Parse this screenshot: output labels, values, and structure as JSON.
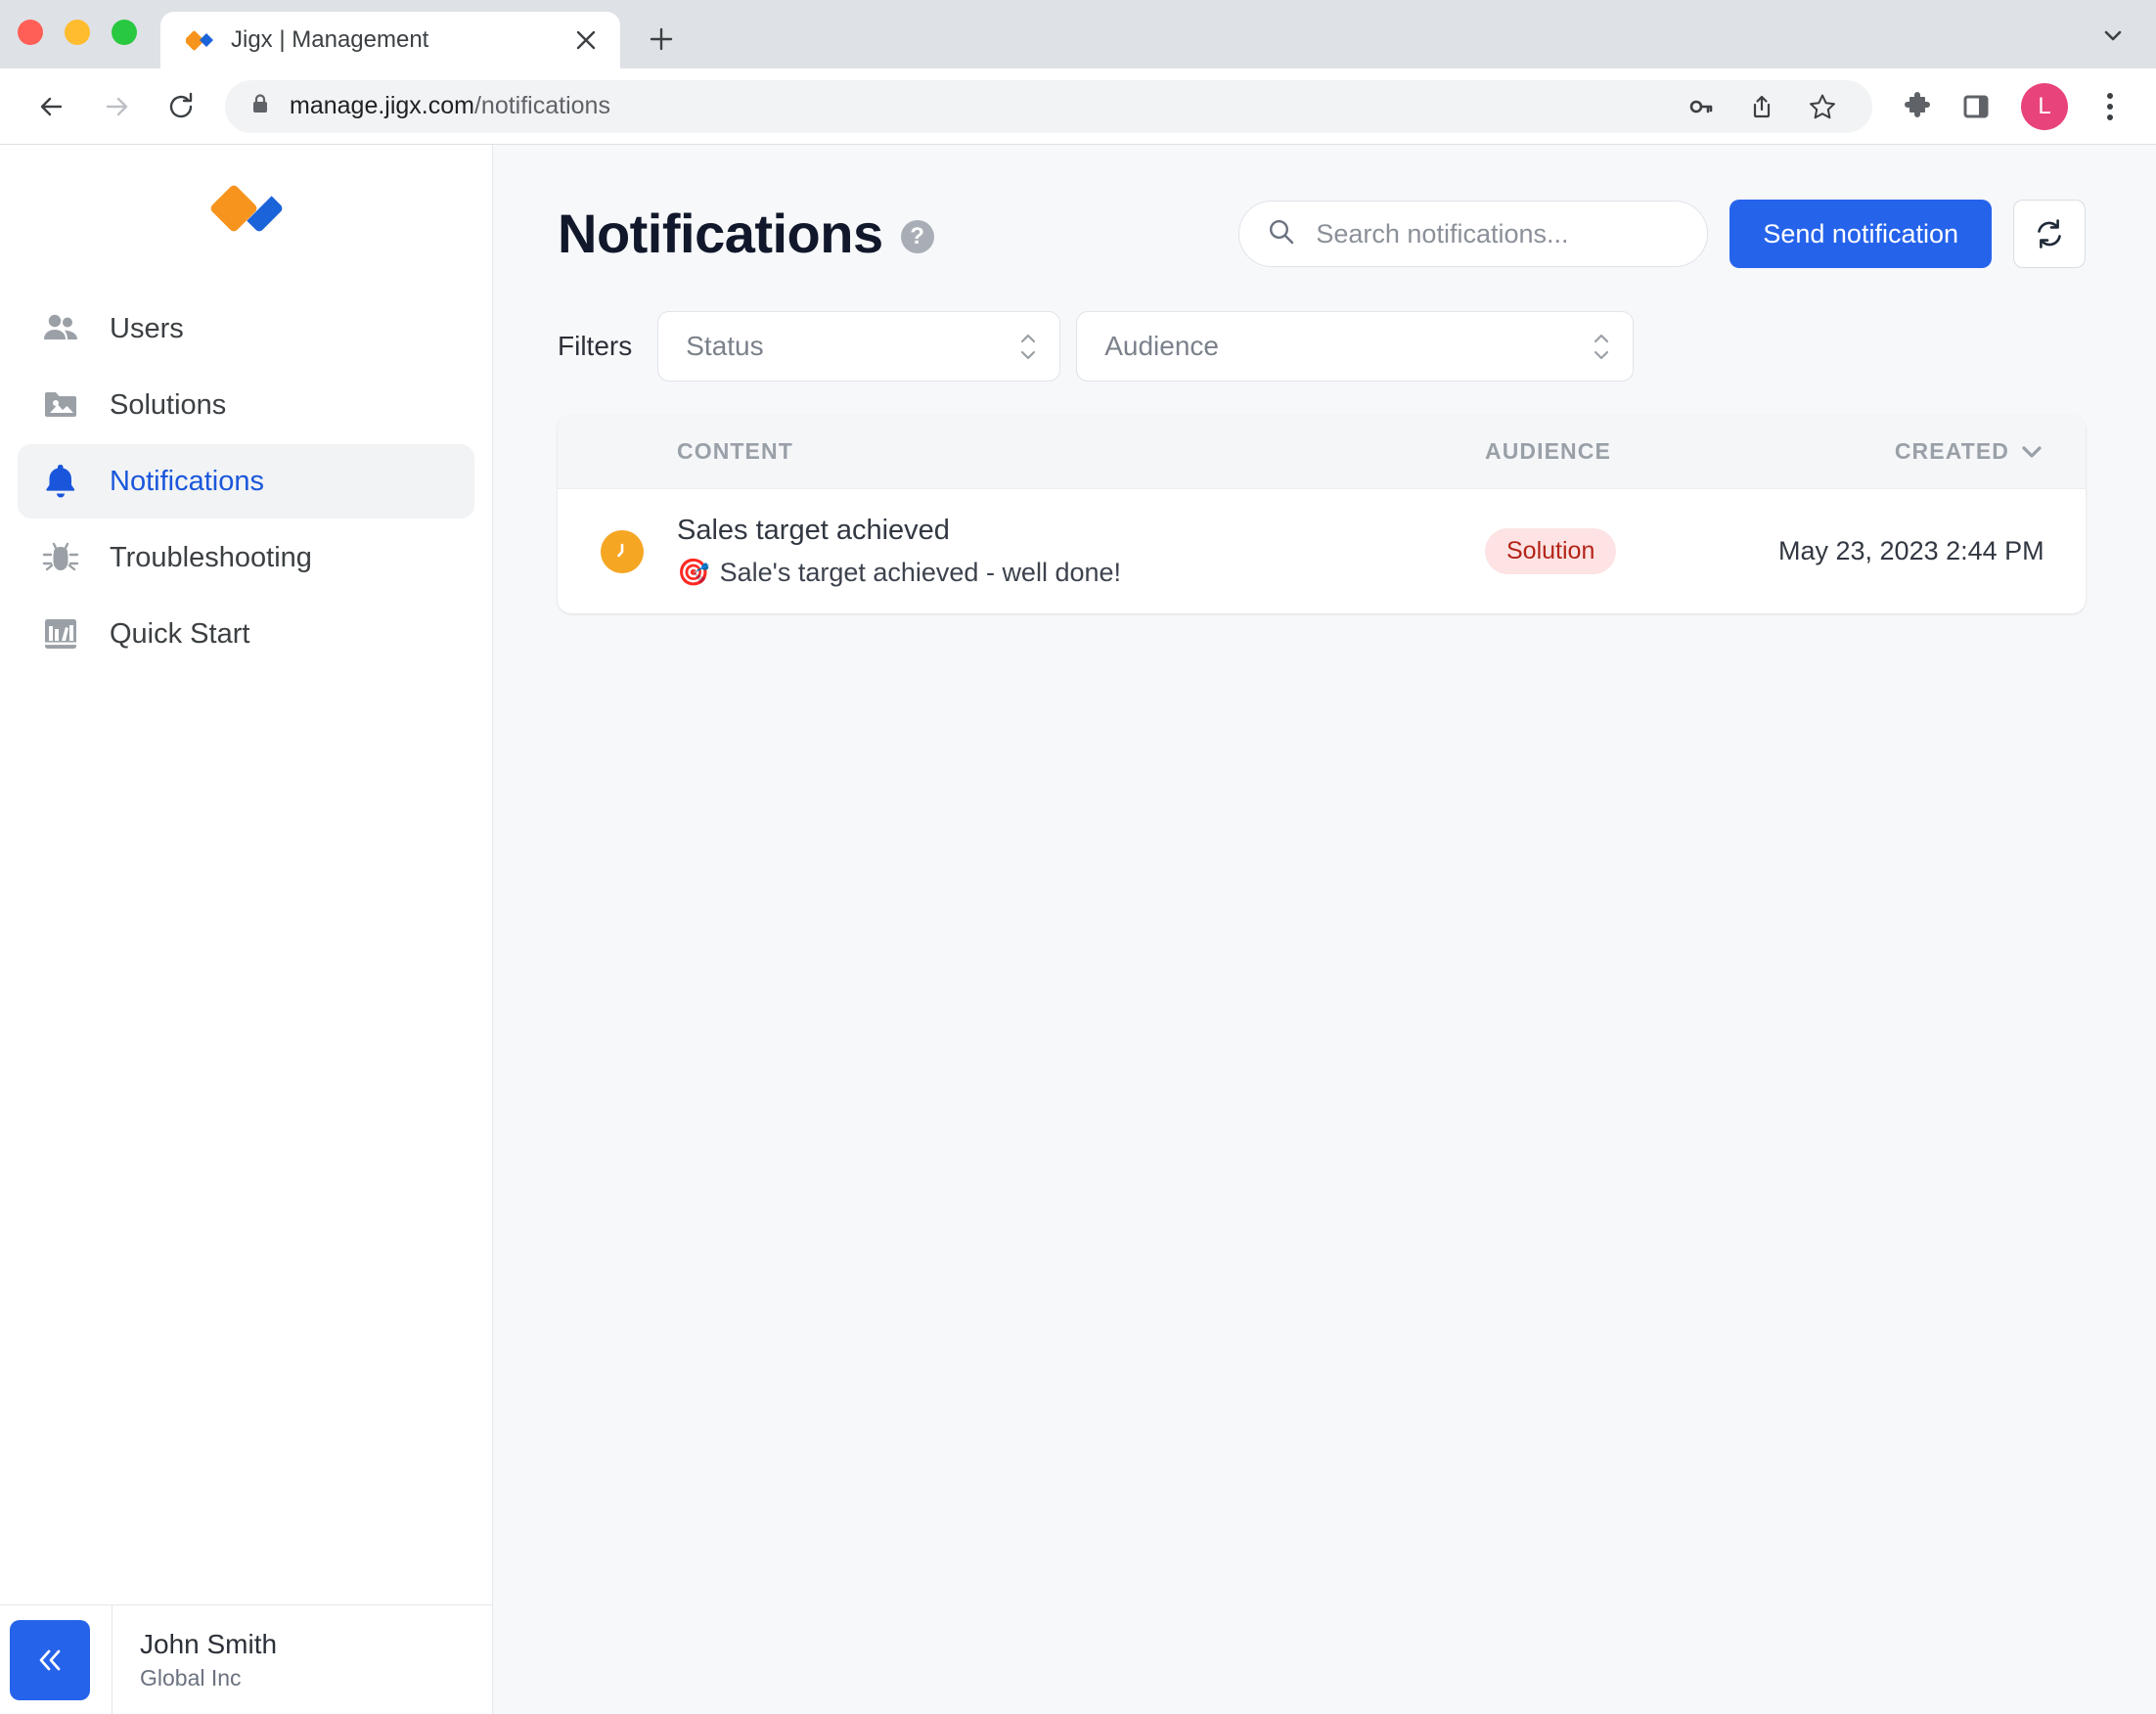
{
  "browser": {
    "tab": {
      "title": "Jigx | Management",
      "favicon_icon": "jigx-logo-icon",
      "close_icon": "close-icon"
    },
    "new_tab_label": "+",
    "tabstrip_chevron_icon": "chevron-down-icon",
    "nav": {
      "back_icon": "back-arrow-icon",
      "forward_icon": "forward-arrow-icon",
      "reload_icon": "reload-icon"
    },
    "omnibox": {
      "lock_icon": "lock-icon",
      "url_domain": "manage.jigx.com",
      "url_path": "/notifications",
      "password_icon": "key-icon",
      "share_icon": "share-icon",
      "bookmark_icon": "star-icon"
    },
    "extensions_icon": "puzzle-piece-icon",
    "sidepanel_icon": "side-panel-icon",
    "profile_avatar_letter": "L",
    "profile_avatar_color": "#e8437a",
    "menu_icon": "three-dot-menu-icon"
  },
  "sidebar": {
    "logo_name": "jigx-logo",
    "items": [
      {
        "label": "Users",
        "icon": "users-icon",
        "active": false
      },
      {
        "label": "Solutions",
        "icon": "folder-image-icon",
        "active": false
      },
      {
        "label": "Notifications",
        "icon": "bell-icon",
        "active": true
      },
      {
        "label": "Troubleshooting",
        "icon": "bug-icon",
        "active": false
      },
      {
        "label": "Quick Start",
        "icon": "bookshelf-icon",
        "active": false
      }
    ],
    "collapse_icon": "double-chevron-left-icon",
    "user": {
      "name": "John Smith",
      "org": "Global Inc"
    }
  },
  "header": {
    "title": "Notifications",
    "help_icon": "question-mark-icon",
    "search": {
      "placeholder": "Search notifications...",
      "value": "",
      "icon": "search-icon"
    },
    "send_button_label": "Send notification",
    "refresh_icon": "refresh-icon"
  },
  "filters": {
    "label": "Filters",
    "status": {
      "value": "Status",
      "icon": "up-down-chevron-icon"
    },
    "audience": {
      "value": "Audience",
      "icon": "up-down-chevron-icon"
    }
  },
  "table": {
    "columns": {
      "content": "CONTENT",
      "audience": "AUDIENCE",
      "created": "CREATED",
      "created_sort_icon": "chevron-down-icon"
    },
    "rows": [
      {
        "status_icon": "clock-icon",
        "title": "Sales target achieved",
        "emoji": "🎯",
        "subtitle": "Sale's target achieved - well done!",
        "audience_badge": "Solution",
        "created": "May 23, 2023 2:44 PM"
      }
    ]
  },
  "colors": {
    "accent_blue": "#2563eb",
    "nav_active_blue": "#1a56db",
    "brand_orange": "#f7941e",
    "badge_bg": "#fde3e3",
    "badge_text": "#b42318",
    "status_orange": "#f5a623"
  }
}
